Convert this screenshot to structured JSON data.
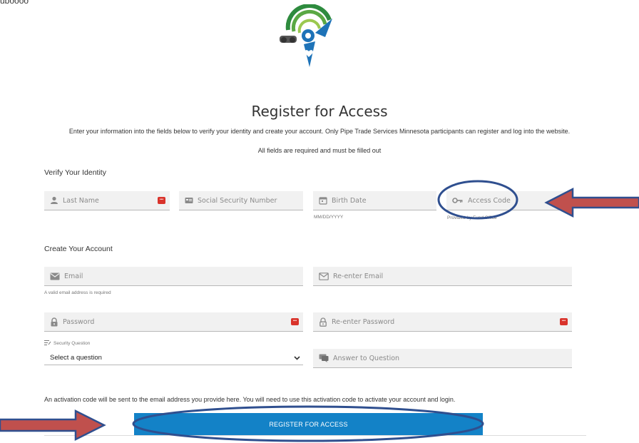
{
  "header": {
    "crumb": "uboooo"
  },
  "page": {
    "title": "Register for Access",
    "subtitle": "Enter your information into the fields below to verify your identity and create your account. Only Pipe Trade Services Minnesota participants can register and log into the website.",
    "required_note": "All fields are required and must be filled out"
  },
  "verify": {
    "heading": "Verify Your Identity",
    "last_name": {
      "placeholder": "Last Name"
    },
    "ssn": {
      "placeholder": "Social Security Number"
    },
    "birth_date": {
      "placeholder": "Birth Date",
      "hint": "MM/DD/YYYY"
    },
    "access_code": {
      "placeholder": "Access Code",
      "hint": "Provided by Fund Office"
    }
  },
  "account": {
    "heading": "Create Your Account",
    "email": {
      "placeholder": "Email",
      "hint": "A valid email address is required"
    },
    "reenter_email": {
      "placeholder": "Re-enter Email"
    },
    "password": {
      "placeholder": "Password"
    },
    "reenter_password": {
      "placeholder": "Re-enter Password"
    },
    "security_question": {
      "label": "Security Question",
      "selected": "Select a question"
    },
    "answer": {
      "placeholder": "Answer to Question"
    }
  },
  "footer": {
    "activation_note": "An activation code will be sent to the email address you provide here. You will need to use this activation code to activate your account and login.",
    "register_button": "REGISTER FOR ACCESS"
  },
  "colors": {
    "primary_button": "#1382c7",
    "badge": "#d9332b",
    "annotation_arrow": "#c0504d",
    "annotation_outline": "#2f4f8f"
  },
  "icons": [
    "person-icon",
    "card-icon",
    "calendar-icon",
    "key-icon",
    "envelope-icon",
    "envelope-outline-icon",
    "lock-icon",
    "lock-outline-icon",
    "question-list-icon",
    "chat-icon",
    "chevron-down-icon",
    "password-manager-badge-icon"
  ]
}
